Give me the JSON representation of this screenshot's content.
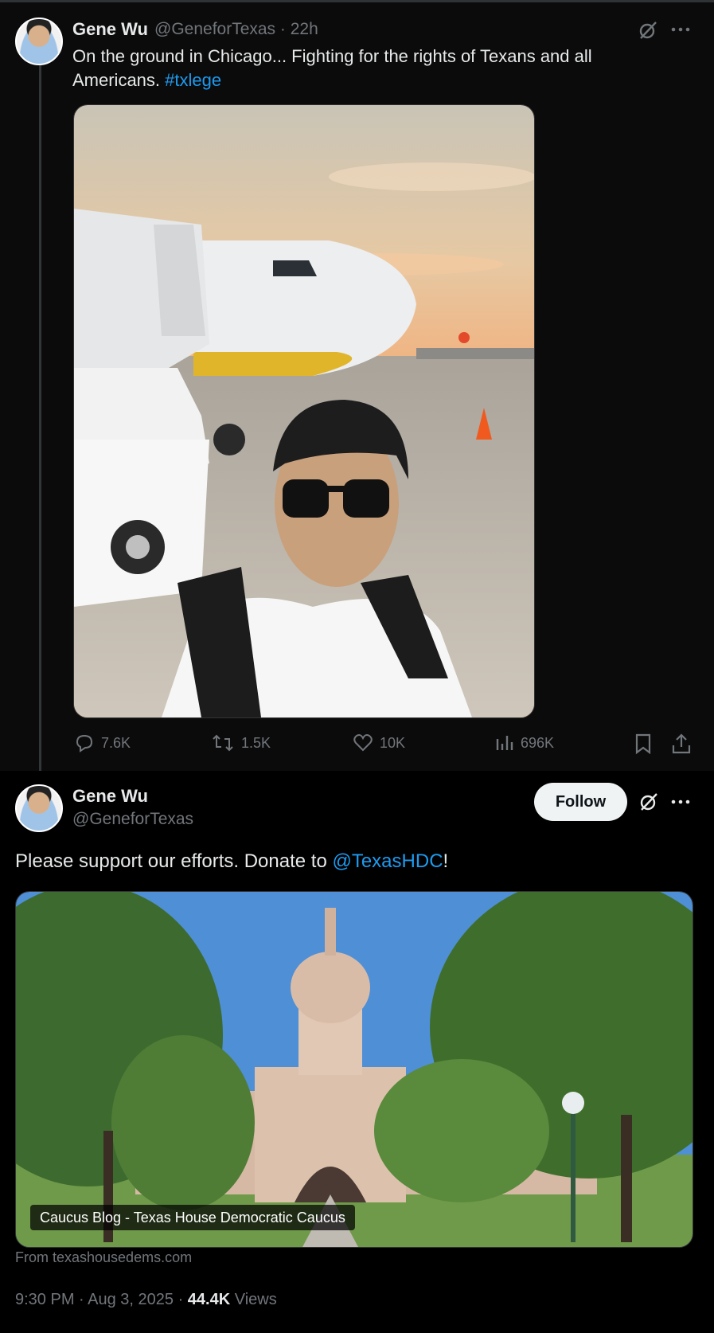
{
  "tweet1": {
    "name": "Gene Wu",
    "handle": "@GeneforTexas",
    "time": "· 22h",
    "text_line1": "On the ground in Chicago... Fighting for the rights of Texans and all",
    "text_line2": "Americans. ",
    "hashtag": "#txlege",
    "stats": {
      "replies": "7.6K",
      "reposts": "1.5K",
      "likes": "10K",
      "views": "696K"
    },
    "image_description_icon": "selfie-airplane-photo"
  },
  "tweet2": {
    "name": "Gene Wu",
    "handle": "@GeneforTexas",
    "follow_label": "Follow",
    "text_before": "Please support our efforts. Donate to ",
    "mention": "@TexasHDC",
    "text_after": "!",
    "card_title": "Caucus Blog - Texas House Democratic Caucus",
    "card_source": "From texashousedems.com",
    "timestamp": "9:30 PM · Aug 3, 2025 · ",
    "views_count": "44.4K",
    "views_label": " Views"
  },
  "colors": {
    "accent": "#1d9bf0",
    "muted": "#71767b",
    "text": "#e7e9ea",
    "background": "#000000"
  }
}
